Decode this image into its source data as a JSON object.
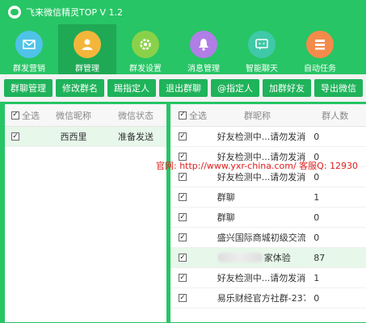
{
  "app": {
    "title": "飞来微信精灵TOP  V 1.2"
  },
  "nav": [
    {
      "label": "群发营销",
      "icon": "mail-icon",
      "color": "#4fc3e8"
    },
    {
      "label": "群管理",
      "icon": "user-icon",
      "color": "#f4b63a"
    },
    {
      "label": "群发设置",
      "icon": "gear-icon",
      "color": "#8ad14a"
    },
    {
      "label": "消息管理",
      "icon": "bell-icon",
      "color": "#b07ee6"
    },
    {
      "label": "智能聊天",
      "icon": "chat-icon",
      "color": "#3fc9a8"
    },
    {
      "label": "自动任务",
      "icon": "task-icon",
      "color": "#f48b4a"
    }
  ],
  "toolbar": [
    "群聊管理",
    "修改群名",
    "踢指定人",
    "退出群聊",
    "@指定人",
    "加群好友",
    "导出微信"
  ],
  "left_table": {
    "headers": {
      "select_all": "全选",
      "nickname": "微信昵称",
      "status": "微信状态"
    },
    "rows": [
      {
        "checked": true,
        "nickname": "西西里",
        "status": "准备发送"
      }
    ]
  },
  "right_table": {
    "headers": {
      "select_all": "全选",
      "group_name": "群昵称",
      "member_count": "群人数"
    },
    "rows": [
      {
        "checked": true,
        "name": "好友检测中...请勿发消",
        "count": "0"
      },
      {
        "checked": true,
        "name": "好友检测中...请勿发消",
        "count": "0"
      },
      {
        "checked": true,
        "name": "好友检测中...请勿发消",
        "count": "0"
      },
      {
        "checked": true,
        "name": "群聊",
        "count": "1"
      },
      {
        "checked": true,
        "name": "群聊",
        "count": "0"
      },
      {
        "checked": true,
        "name": "盛兴国际商城初级交流",
        "count": "0"
      },
      {
        "checked": true,
        "name": "家体验",
        "count": "87",
        "blurred_prefix": true
      },
      {
        "checked": true,
        "name": "好友检测中...请勿发消",
        "count": "1"
      },
      {
        "checked": true,
        "name": "易乐财经官方社群-237",
        "count": "0"
      }
    ]
  },
  "watermark": "官网: http://www.yxr-china.com/  客服Q: 12930"
}
